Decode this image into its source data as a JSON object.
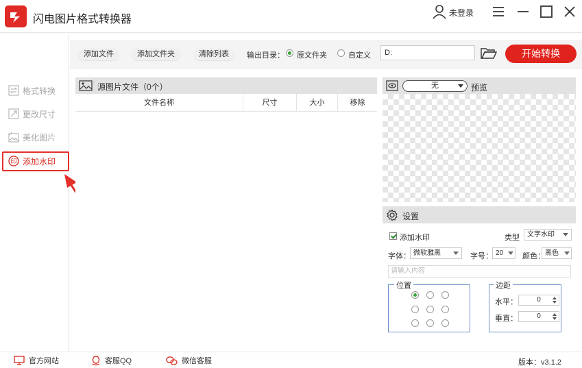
{
  "app": {
    "title": "闪电图片格式转换器",
    "login": "未登录"
  },
  "sidebar": {
    "items": [
      {
        "label": "格式转换",
        "icon": "format-convert-icon",
        "active": false
      },
      {
        "label": "更改尺寸",
        "icon": "resize-icon",
        "active": false
      },
      {
        "label": "美化图片",
        "icon": "beautify-icon",
        "active": false
      },
      {
        "label": "添加水印",
        "icon": "watermark-stamp-icon",
        "active": true
      }
    ]
  },
  "toolbar": {
    "add_file": "添加文件",
    "add_folder": "添加文件夹",
    "clear_list": "清除列表",
    "output_dir_label": "输出目录：",
    "original_folder": "原文件夹",
    "custom": "自定义",
    "path": "D:",
    "start": "开始转换"
  },
  "file_list": {
    "title": "源图片文件（0个）",
    "columns": [
      "文件名称",
      "尺寸",
      "大小",
      "移除"
    ]
  },
  "preview": {
    "select_value": "无",
    "label": "预览"
  },
  "settings": {
    "title": "设置",
    "add_watermark": "添加水印",
    "type_label": "类型",
    "type_value": "文字水印",
    "font_label": "字体：",
    "font_value": "微软雅黑",
    "size_label": "字号：",
    "size_value": "20",
    "color_label": "颜色：",
    "color_value": "黑色",
    "text_placeholder": "请输入内容",
    "position_label": "位置",
    "margin_label": "边距",
    "horizontal_label": "水平：",
    "horizontal_value": "0",
    "vertical_label": "垂直：",
    "vertical_value": "0"
  },
  "footer": {
    "website": "官方网站",
    "qq": "客服QQ",
    "wechat": "微信客服",
    "version": "版本：v3.1.2"
  },
  "colors": {
    "accent": "#e0231d",
    "header_gray": "#e2e2e2",
    "group_border": "#6a8fc8"
  }
}
